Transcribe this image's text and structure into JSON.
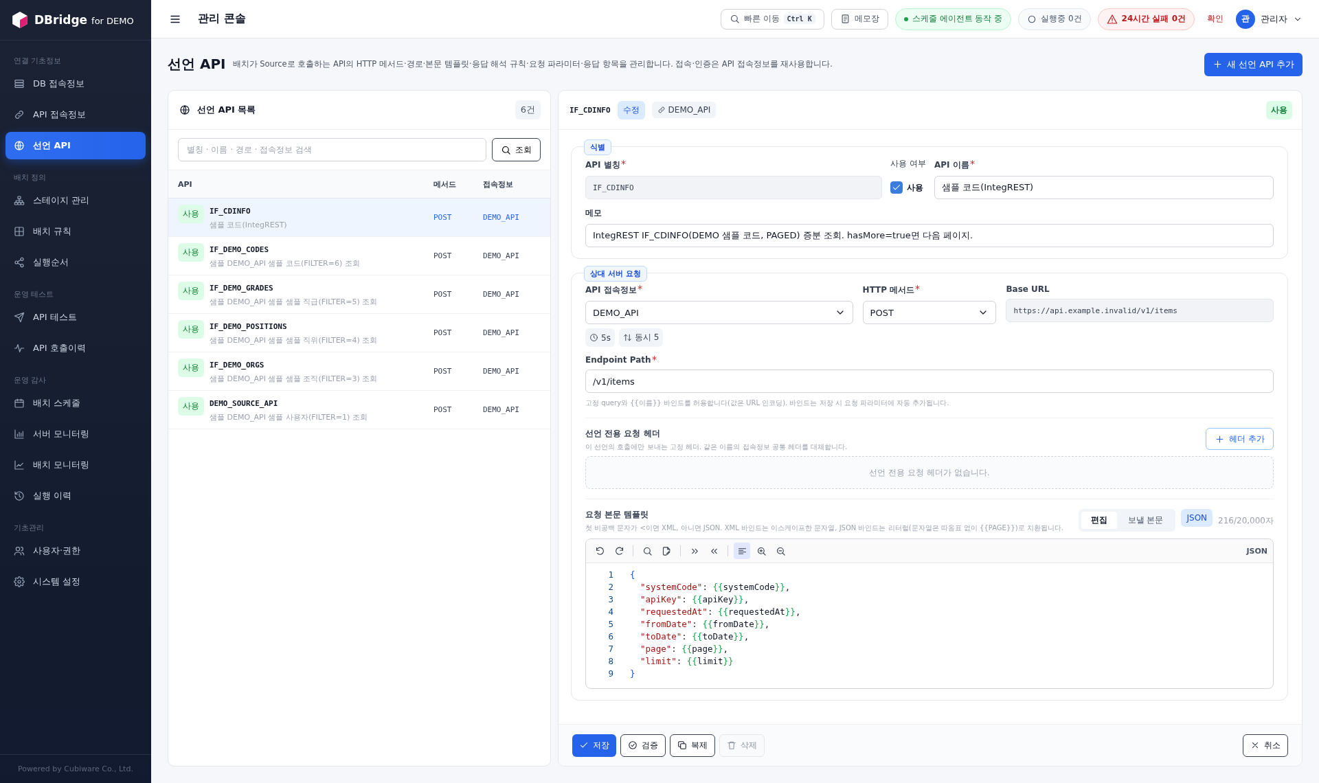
{
  "sidebar": {
    "brand": "DBridge",
    "brand_suffix": "for DEMO",
    "sections": [
      {
        "title": "연결 기초정보",
        "items": [
          {
            "label": "DB 접속정보",
            "selected": false
          },
          {
            "label": "API 접속정보",
            "selected": false
          },
          {
            "label": "선언 API",
            "selected": true
          }
        ]
      },
      {
        "title": "배치 정의",
        "items": [
          {
            "label": "스테이지 관리",
            "selected": false
          },
          {
            "label": "배치 규칙",
            "selected": false
          },
          {
            "label": "실행순서",
            "selected": false
          }
        ]
      },
      {
        "title": "운영 테스트",
        "items": [
          {
            "label": "API 테스트",
            "selected": false
          },
          {
            "label": "API 호출이력",
            "selected": false
          }
        ]
      },
      {
        "title": "운영 감사",
        "items": [
          {
            "label": "배치 스케줄",
            "selected": false
          },
          {
            "label": "서버 모니터링",
            "selected": false
          },
          {
            "label": "배치 모니터링",
            "selected": false
          },
          {
            "label": "실행 이력",
            "selected": false
          }
        ]
      },
      {
        "title": "기초관리",
        "items": [
          {
            "label": "사용자·권한",
            "selected": false
          },
          {
            "label": "시스템 설정",
            "selected": false
          }
        ]
      }
    ],
    "footer": "Powered by Cubiware Co., Ltd."
  },
  "topbar": {
    "title": "관리 콘솔",
    "quick_nav": {
      "label": "빠른 이동",
      "shortcut": "Ctrl K"
    },
    "memo": "메모장",
    "statuses": [
      {
        "kind": "success",
        "label": "스케줄 에이전트 동작 중"
      },
      {
        "kind": "neutral",
        "label": "실행중 0건"
      },
      {
        "kind": "danger",
        "label": "24시간 실패 0건"
      }
    ],
    "confirm": "확인",
    "user": {
      "avatar": "관",
      "name": "관리자"
    }
  },
  "page": {
    "title": "선언 API",
    "description": "배치가 Source로 호출하는 API의 HTTP 메서드·경로·본문 템플릿·응답 해석 규칙·요청 파라미터·응답 항목을 관리합니다. 접속·인증은 API 접속정보를 재사용합니다.",
    "add_button": "새 선언 API 추가"
  },
  "list": {
    "title": "선언 API 목록",
    "count": "6건",
    "search": {
      "placeholder": "별칭 · 이름 · 경로 · 접속정보 검색",
      "button": "조회"
    },
    "columns": [
      "API",
      "메서드",
      "접속정보"
    ],
    "rows": [
      {
        "status": "사용",
        "alias": "IF_CDINFO",
        "name": "샘플 코드(IntegREST)",
        "method": "POST",
        "connection": "DEMO_API",
        "selected": true
      },
      {
        "status": "사용",
        "alias": "IF_DEMO_CODES",
        "name": "샘플 DEMO_API 샘플 코드(FILTER=6) 조회",
        "method": "POST",
        "connection": "DEMO_API",
        "selected": false
      },
      {
        "status": "사용",
        "alias": "IF_DEMO_GRADES",
        "name": "샘플 DEMO_API 샘플 샘플 직급(FILTER=5) 조회",
        "method": "POST",
        "connection": "DEMO_API",
        "selected": false
      },
      {
        "status": "사용",
        "alias": "IF_DEMO_POSITIONS",
        "name": "샘플 DEMO_API 샘플 샘플 직위(FILTER=4) 조회",
        "method": "POST",
        "connection": "DEMO_API",
        "selected": false
      },
      {
        "status": "사용",
        "alias": "IF_DEMO_ORGS",
        "name": "샘플 DEMO_API 샘플 샘플 조직(FILTER=3) 조회",
        "method": "POST",
        "connection": "DEMO_API",
        "selected": false
      },
      {
        "status": "사용",
        "alias": "DEMO_SOURCE_API",
        "name": "샘플 DEMO_API 샘플 사용자(FILTER=1) 조회",
        "method": "POST",
        "connection": "DEMO_API",
        "selected": false
      }
    ]
  },
  "detail": {
    "alias": "IF_CDINFO",
    "mode": "수정",
    "connection": "DEMO_API",
    "status": "사용",
    "identity": {
      "legend": "식별",
      "alias": {
        "label": "API 별칭",
        "required": true,
        "value": "IF_CDINFO"
      },
      "enabled": {
        "label": "사용 여부",
        "checked": true,
        "text": "사용"
      },
      "name": {
        "label": "API 이름",
        "required": true,
        "value": "샘플 코드(IntegREST)"
      },
      "memo": {
        "label": "메모",
        "required": false,
        "value": "IntegREST IF_CDINFO(DEMO 샘플 코드, PAGED) 증분 조회. hasMore=true면 다음 페이지."
      }
    },
    "request": {
      "legend": "상대 서버 요청",
      "connection": {
        "label": "API 접속정보",
        "required": true,
        "value": "DEMO_API"
      },
      "method": {
        "label": "HTTP 메서드",
        "required": true,
        "value": "POST"
      },
      "base_url": {
        "label": "Base URL",
        "required": false,
        "value": "https://api.example.invalid/v1/items"
      },
      "chips": [
        "5s",
        "동시 5"
      ],
      "endpoint": {
        "label": "Endpoint Path",
        "required": true,
        "value": "/v1/items",
        "hint": "고정 query와 {{이름}} 바인드를 허용합니다(값은 URL 인코딩). 바인드는 저장 시 요청 파라미터에 자동 추가됩니다."
      },
      "headers": {
        "title": "선언 전용 요청 헤더",
        "description": "이 선언의 호출에만 보내는 고정 헤더. 같은 이름의 접속정보 공통 헤더를 대체합니다.",
        "add_button": "헤더 추가",
        "empty": "선언 전용 요청 헤더가 없습니다."
      },
      "body": {
        "title": "요청 본문 템플릿",
        "description": "첫 비공백 문자가 <이면 XML, 아니면 JSON. XML 바인드는 이스케이프한 문자열, JSON 바인드는 리터럴(문자열은 따옴표 없이 {{PAGE}})로 치환됩니다.",
        "tabs": [
          {
            "label": "편집",
            "selected": true
          },
          {
            "label": "보낼 본문",
            "selected": false
          }
        ],
        "format": "JSON",
        "count": "216/20,000자",
        "editor_language": "JSON",
        "lines": [
          {
            "number": "1",
            "text": "{"
          },
          {
            "number": "2",
            "text": "  \"systemCode\": {{systemCode}},"
          },
          {
            "number": "3",
            "text": "  \"apiKey\": {{apiKey}},"
          },
          {
            "number": "4",
            "text": "  \"requestedAt\": {{requestedAt}},"
          },
          {
            "number": "5",
            "text": "  \"fromDate\": {{fromDate}},"
          },
          {
            "number": "6",
            "text": "  \"toDate\": {{toDate}},"
          },
          {
            "number": "7",
            "text": "  \"page\": {{page}},"
          },
          {
            "number": "8",
            "text": "  \"limit\": {{limit}}"
          },
          {
            "number": "9",
            "text": "}"
          }
        ]
      }
    },
    "actions": [
      {
        "kind": "primary",
        "label": "저장",
        "disabled": false
      },
      {
        "kind": "secondary",
        "label": "검증",
        "disabled": false
      },
      {
        "kind": "secondary",
        "label": "복제",
        "disabled": false
      },
      {
        "kind": "secondary",
        "label": "삭제",
        "disabled": true
      },
      {
        "kind": "cancel",
        "label": "취소",
        "disabled": false
      }
    ]
  }
}
